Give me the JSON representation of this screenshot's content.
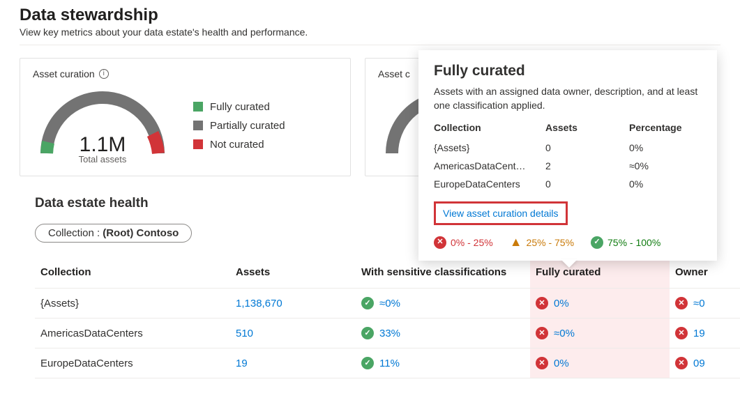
{
  "page": {
    "title": "Data stewardship",
    "subtitle": "View key metrics about your data estate's health and performance."
  },
  "colors": {
    "fully": "#4aa564",
    "partial": "#737373",
    "not": "#d13438"
  },
  "card1": {
    "title": "Asset curation",
    "gauge_value": "1.1M",
    "gauge_label": "Total assets",
    "legend": {
      "fully": "Fully curated",
      "partial": "Partially curated",
      "not": "Not curated"
    }
  },
  "card2": {
    "title": "Asset c"
  },
  "popover": {
    "title": "Fully curated",
    "description": "Assets with an assigned data owner, description, and at least one classification applied.",
    "headers": {
      "collection": "Collection",
      "assets": "Assets",
      "percentage": "Percentage"
    },
    "rows": [
      {
        "collection": "{Assets}",
        "assets": "0",
        "percentage": "0%"
      },
      {
        "collection": "AmericasDataCent…",
        "assets": "2",
        "percentage": "≈0%"
      },
      {
        "collection": "EuropeDataCenters",
        "assets": "0",
        "percentage": "0%"
      }
    ],
    "view_link": "View asset curation details",
    "legend": {
      "low": "0% - 25%",
      "mid": "25% - 75%",
      "high": "75% - 100%"
    }
  },
  "health": {
    "section_title": "Data estate health",
    "filter": {
      "label": "Collection : ",
      "value": "(Root) Contoso"
    },
    "headers": {
      "collection": "Collection",
      "assets": "Assets",
      "sensitive": "With sensitive classifications",
      "fully": "Fully curated",
      "owner": "Owner"
    },
    "rows": [
      {
        "collection": "{Assets}",
        "assets": "1,138,670",
        "sensitive": "≈0%",
        "sensitive_state": "ok",
        "fully": "0%",
        "fully_state": "bad",
        "owner": "≈0",
        "owner_state": "bad"
      },
      {
        "collection": "AmericasDataCenters",
        "assets": "510",
        "sensitive": "33%",
        "sensitive_state": "ok",
        "fully": "≈0%",
        "fully_state": "bad",
        "owner": "19",
        "owner_state": "bad"
      },
      {
        "collection": "EuropeDataCenters",
        "assets": "19",
        "sensitive": "11%",
        "sensitive_state": "ok",
        "fully": "0%",
        "fully_state": "bad",
        "owner": "09",
        "owner_state": "bad"
      }
    ]
  },
  "chart_data": {
    "type": "pie",
    "title": "Asset curation",
    "gauge_style": "semi-donut",
    "total_label": "Total assets",
    "total_display": "1.1M",
    "series": [
      {
        "name": "Fully curated",
        "value_pct": 2,
        "color": "#4aa564"
      },
      {
        "name": "Partially curated",
        "value_pct": 90,
        "color": "#737373"
      },
      {
        "name": "Not curated",
        "value_pct": 8,
        "color": "#d13438"
      }
    ]
  }
}
